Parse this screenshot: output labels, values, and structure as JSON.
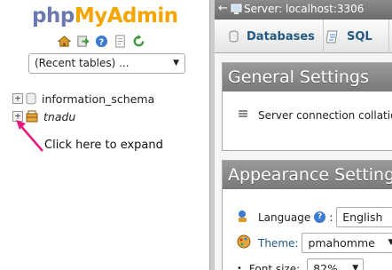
{
  "nav": {
    "logo_part1": "php",
    "logo_part2": "MyAdmin",
    "icons": [
      "home-icon",
      "exit-icon",
      "help-icon",
      "docs-icon",
      "reload-icon"
    ],
    "recent_tables": "(Recent tables) ...",
    "databases": [
      {
        "name": "information_schema",
        "expander": "+"
      },
      {
        "name": "tnadu",
        "expander": "+"
      }
    ],
    "annotation": "Click here to expand",
    "annotation_color": "#e8197d"
  },
  "topbar": {
    "back": "←",
    "server": "Server: localhost:3306"
  },
  "tabs": {
    "databases": "Databases",
    "sql": "SQL"
  },
  "general": {
    "title": "General Settings",
    "collation_label": "Server connection collation"
  },
  "appearance": {
    "title": "Appearance Settings",
    "language_label": "Language",
    "language_value": "English",
    "theme_label": "Theme:",
    "theme_value": "pmahomme",
    "font_label": "Font size:",
    "font_value": "82%",
    "help_text": "?"
  },
  "colors": {
    "logo_blue": "#6c78af",
    "logo_orange": "#f6a500",
    "link_blue": "#235a81"
  }
}
